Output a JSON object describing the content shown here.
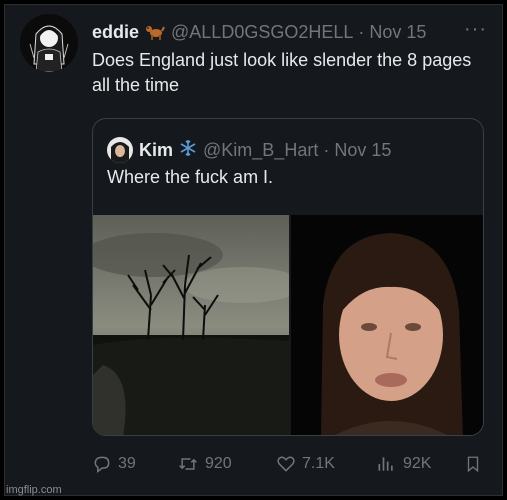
{
  "tweet": {
    "display_name": "eddie",
    "handle": "@ALLD0GSGO2HELL",
    "separator": "·",
    "date": "Nov 15",
    "more": "···",
    "text": "Does England just look like slender the 8 pages all the time",
    "name_emoji_icon": "dog-icon"
  },
  "quote": {
    "display_name": "Kim",
    "emoji_icon": "snowflake-icon",
    "handle": "@Kim_B_Hart",
    "separator": "·",
    "date": "Nov 15",
    "text": "Where the fuck am I.",
    "images": [
      "dark-road-trees-photo",
      "face-selfie-photo"
    ]
  },
  "actions": {
    "replies": "39",
    "reposts": "920",
    "likes": "7.1K",
    "views": "92K"
  },
  "watermark": "imgflip.com",
  "colors": {
    "background": "#15181c",
    "text": "#e7e9ea",
    "muted": "#71767b",
    "border": "#3b3f44",
    "snowflake": "#5b9bd5"
  }
}
